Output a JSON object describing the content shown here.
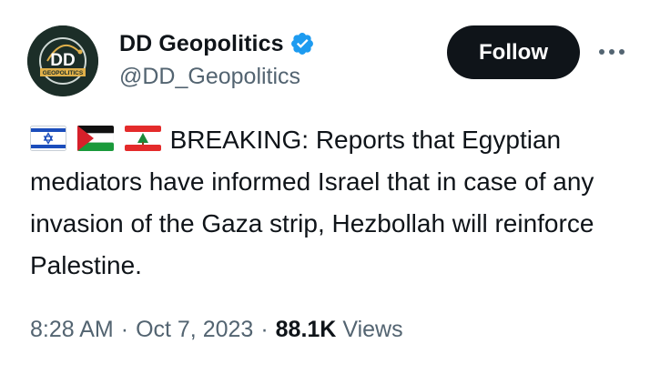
{
  "author": {
    "display_name": "DD Geopolitics",
    "handle": "@DD_Geopolitics",
    "avatar_text": "DD",
    "avatar_subtext": "GEOPOLITICS",
    "verified": true,
    "verified_icon": "verified-badge-icon",
    "verified_color": "#1d9bf0"
  },
  "actions": {
    "follow_label": "Follow",
    "more_icon": "more-horizontal-icon"
  },
  "tweet": {
    "flags": [
      "israel-flag-icon",
      "palestine-flag-icon",
      "lebanon-flag-icon"
    ],
    "text": "BREAKING: Reports that Egyptian mediators have informed Israel that in case of any invasion of the Gaza strip, Hezbollah will reinforce Palestine."
  },
  "meta": {
    "time": "8:28 AM",
    "date": "Oct 7, 2023",
    "separator": "·",
    "views_count": "88.1K",
    "views_label": "Views"
  },
  "colors": {
    "text_primary": "#0f1419",
    "text_secondary": "#536471",
    "follow_bg": "#0f1419",
    "avatar_bg": "#1c2e28",
    "avatar_accent": "#e0b04a"
  }
}
